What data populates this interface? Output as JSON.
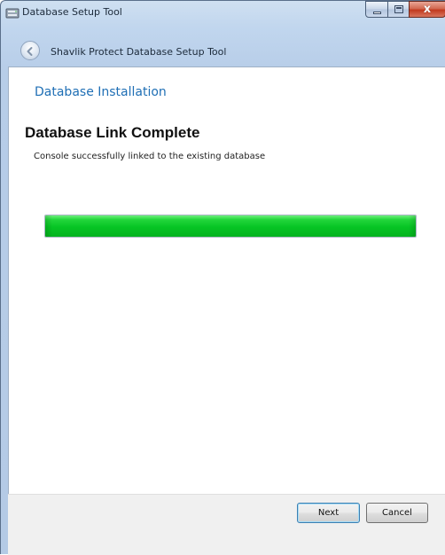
{
  "window": {
    "title": "Database Setup Tool",
    "icon": "database-icon"
  },
  "caption_buttons": {
    "minimize_icon": "minimize-icon",
    "maximize_icon": "maximize-icon",
    "close_glyph": "x"
  },
  "nav": {
    "back_icon": "back-arrow-icon",
    "title": "Shavlik Protect Database Setup Tool"
  },
  "page": {
    "section_header": "Database Installation",
    "heading": "Database Link Complete",
    "status_message": "Console successfully linked to the existing database"
  },
  "progress": {
    "value_percent": 100,
    "color": "#06c424"
  },
  "footer": {
    "next_label": "Next",
    "cancel_label": "Cancel"
  },
  "colors": {
    "section_header": "#1f6fb5",
    "close_button": "#c23a1f"
  }
}
